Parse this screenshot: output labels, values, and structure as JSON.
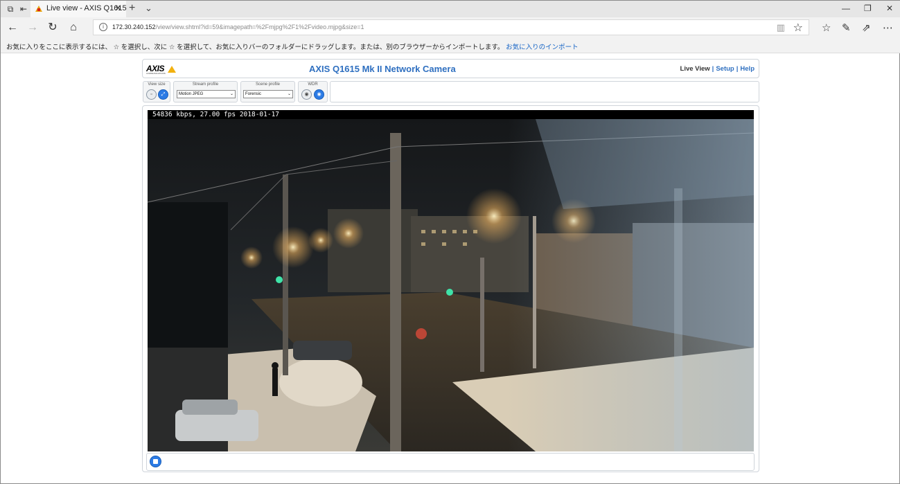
{
  "browser": {
    "tab_title": "Live view - AXIS Q1615",
    "tab_close": "✕",
    "new_tab": "+",
    "url_host": "172.30.240.152",
    "url_path": "/view/view.shtml?id=59&imagepath=%2Fmjpg%2F1%2Fvideo.mjpg&size=1",
    "favorites_bar_text": "お気に入りをここに表示するには、 ☆ を選択し、次に ☆ を選択して、お気に入りバーのフォルダーにドラッグします。または、別のブラウザーからインポートします。",
    "favorites_bar_link": "お気に入りのインポート"
  },
  "camera": {
    "logo_text": "AXIS",
    "logo_sub": "COMMUNICATIONS",
    "title": "AXIS Q1615 Mk II Network Camera",
    "nav": {
      "live_view": "Live View",
      "setup": "Setup",
      "help": "Help",
      "separator": "|"
    },
    "controls": {
      "view_size_label": "View size",
      "stream_profile_label": "Stream profile",
      "stream_profile_value": "Motion JPEG",
      "scene_profile_label": "Scene profile",
      "scene_profile_value": "Forensic",
      "wdr_label": "WDR"
    },
    "overlay_text": "54836 kbps, 27.00 fps 2018-01-17"
  },
  "colors": {
    "link_blue": "#2e6fc0",
    "button_blue": "#2c7be5",
    "axis_yellow": "#f2b10f"
  }
}
